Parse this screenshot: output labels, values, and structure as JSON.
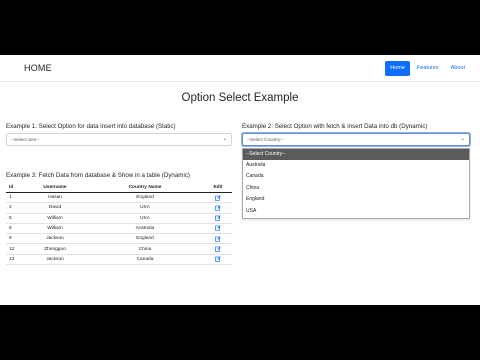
{
  "navbar": {
    "brand": "HOME",
    "items": [
      {
        "label": "Home",
        "active": true
      },
      {
        "label": "Features",
        "active": false
      },
      {
        "label": "About",
        "active": false
      }
    ]
  },
  "page_title": "Option Select Example",
  "example1": {
    "label": "Example 1: Select Option for data insert into database (Static)",
    "select_value": "--Select Sex--"
  },
  "example2": {
    "label": "Example 2: Select Option with fetch & insert Data into db (Dynamic)",
    "select_value": "--Select Country--",
    "options": [
      "--Select Country--",
      "Australia",
      "Canada",
      "China",
      "England",
      "USA"
    ],
    "selected_index": 0
  },
  "example3": {
    "label": "Example 3: Fetch Data from database & Show in a table (Dynamic)",
    "columns": [
      "Id",
      "Username",
      "Country Name",
      "Edit"
    ],
    "rows": [
      {
        "id": "1",
        "username": "Hasan",
        "country": "England"
      },
      {
        "id": "2",
        "username": "David",
        "country": "USA"
      },
      {
        "id": "5",
        "username": "William",
        "country": "USA"
      },
      {
        "id": "6",
        "username": "William",
        "country": "Australia"
      },
      {
        "id": "9",
        "username": "Jackson",
        "country": "England"
      },
      {
        "id": "12",
        "username": "Zhongguo",
        "country": "China"
      },
      {
        "id": "13",
        "username": "Jackson",
        "country": "Canada"
      }
    ],
    "edit_icon": "edit-icon"
  },
  "colors": {
    "primary": "#0d6efd",
    "selected_option_bg": "#5b5b5b",
    "letterbox": "#000000"
  }
}
